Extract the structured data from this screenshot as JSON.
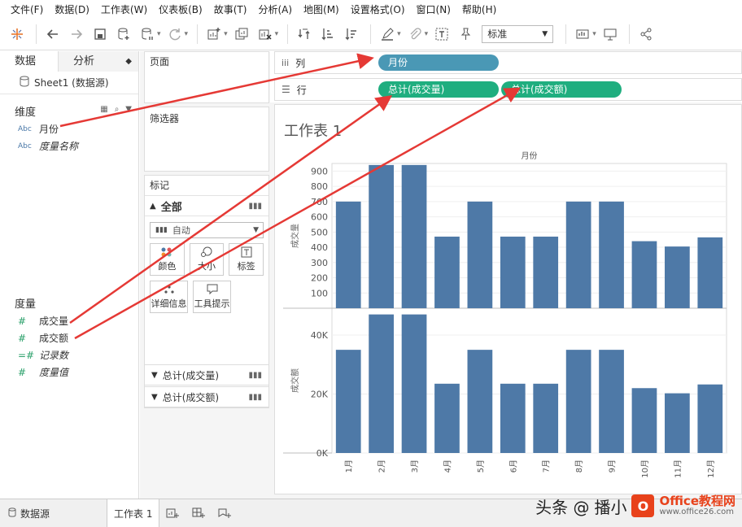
{
  "menu": [
    "文件(F)",
    "数据(D)",
    "工作表(W)",
    "仪表板(B)",
    "故事(T)",
    "分析(A)",
    "地图(M)",
    "设置格式(O)",
    "窗口(N)",
    "帮助(H)"
  ],
  "toolbar": {
    "fit_value": "标准"
  },
  "datapane": {
    "tab_data": "数据",
    "tab_analysis": "分析",
    "datasource": "Sheet1 (数据源)",
    "dimensions_title": "维度",
    "dimensions": [
      {
        "type": "Abc",
        "name": "月份",
        "italic": false
      },
      {
        "type": "Abc",
        "name": "度量名称",
        "italic": true
      }
    ],
    "measures_title": "度量",
    "measures": [
      {
        "type": "#",
        "name": "成交量",
        "italic": false
      },
      {
        "type": "#",
        "name": "成交额",
        "italic": false
      },
      {
        "type": "=#",
        "name": "记录数",
        "italic": true
      },
      {
        "type": "#",
        "name": "度量值",
        "italic": true
      }
    ]
  },
  "cards": {
    "pages": "页面",
    "filters": "筛选器",
    "marks": "标记",
    "marks_all": "全部",
    "mark_type": "自动",
    "buttons": [
      "颜色",
      "大小",
      "标签",
      "详细信息",
      "工具提示"
    ],
    "pill_rows": [
      "总计(成交量)",
      "总计(成交额)"
    ]
  },
  "shelves": {
    "columns_label": "列",
    "rows_label": "行",
    "columns_pills": [
      "月份"
    ],
    "rows_pills": [
      "总计(成交量)",
      "总计(成交额)"
    ]
  },
  "view": {
    "sheet_title": "工作表 1"
  },
  "chart_data": {
    "type": "bar",
    "title": "",
    "header": "月份",
    "categories": [
      "1月",
      "2月",
      "3月",
      "4月",
      "5月",
      "6月",
      "7月",
      "8月",
      "9月",
      "10月",
      "11月",
      "12月"
    ],
    "series": [
      {
        "name": "成交量",
        "values": [
          700,
          940,
          940,
          470,
          700,
          470,
          470,
          700,
          700,
          440,
          405,
          465
        ]
      },
      {
        "name": "成交额",
        "values": [
          35000,
          47000,
          47000,
          23500,
          35000,
          23500,
          23500,
          35000,
          35000,
          22000,
          20250,
          23250
        ]
      }
    ],
    "top_ylabel": "成交量",
    "top_yticks": [
      100,
      200,
      300,
      400,
      500,
      600,
      700,
      800,
      900
    ],
    "top_ylim": [
      0,
      950
    ],
    "bottom_ylabel": "成交额",
    "bottom_yticks": [
      0,
      20000,
      40000
    ],
    "bottom_ytick_labels": [
      "0K",
      "20K",
      "40K"
    ],
    "bottom_ylim": [
      0,
      48000
    ],
    "bar_color": "#4e79a7"
  },
  "tabs": {
    "datasource": "数据源",
    "sheet": "工作表 1"
  },
  "watermark": {
    "text": "头条 @",
    "text2": "播小",
    "brand": "Office教程网",
    "url": "www.office26.com"
  }
}
